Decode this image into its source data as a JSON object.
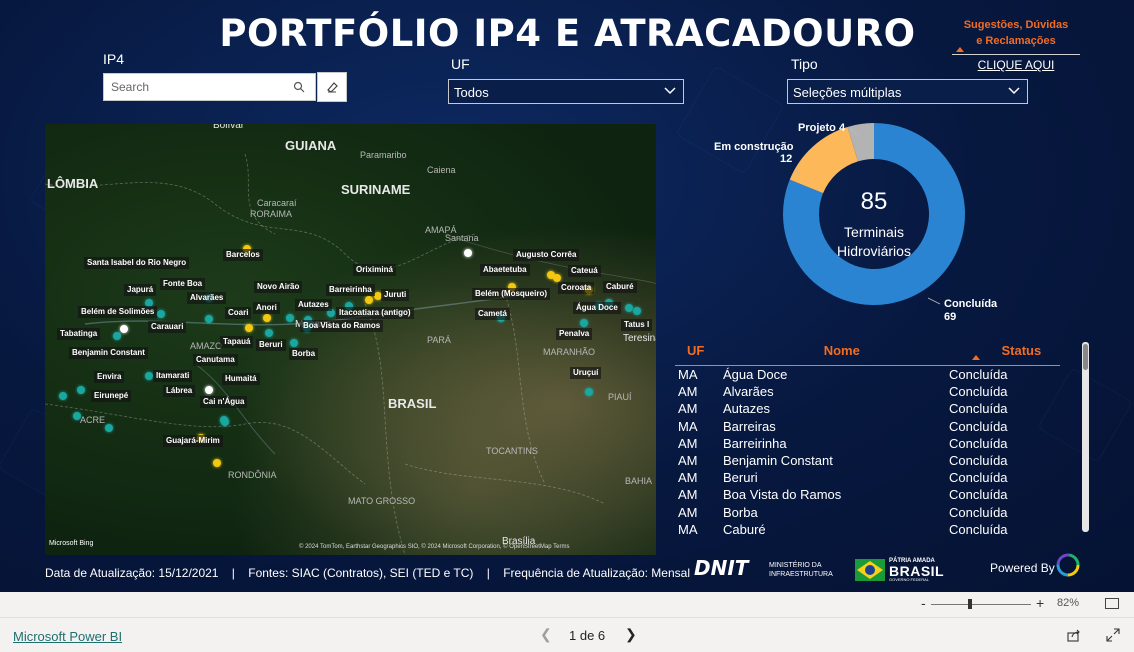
{
  "title": "PORTFÓLIO IP4 E ATRACADOURO",
  "feedback": {
    "line1": "Sugestões, Dúvidas",
    "line2": "e Reclamações",
    "link": "CLIQUE AQUI"
  },
  "filters": {
    "ip4": {
      "label": "IP4",
      "placeholder": "Search"
    },
    "uf": {
      "label": "UF",
      "value": "Todos"
    },
    "tipo": {
      "label": "Tipo",
      "value": "Seleções múltiplas"
    }
  },
  "map": {
    "regions": [
      {
        "text": "Bolívar",
        "cls": "rlbl"
      },
      {
        "text": "GUIANA",
        "cls": "rlbl big"
      },
      {
        "text": "Paramaribo",
        "cls": "rlbl dim"
      },
      {
        "text": "Caiena",
        "cls": "rlbl dim"
      },
      {
        "text": "LÔMBIA",
        "cls": "rlbl big"
      },
      {
        "text": "SURINAME",
        "cls": "rlbl big"
      },
      {
        "text": "Caracaraí",
        "cls": "rlbl dim"
      },
      {
        "text": "RORAIMA",
        "cls": "rlbl dim"
      },
      {
        "text": "AMAPÁ",
        "cls": "rlbl dim"
      },
      {
        "text": "Santana",
        "cls": "rlbl dim"
      },
      {
        "text": "AMAZO",
        "cls": "rlbl dim"
      },
      {
        "text": "PARÁ",
        "cls": "rlbl dim"
      },
      {
        "text": "MARANHÃO",
        "cls": "rlbl dim"
      },
      {
        "text": "Teresina",
        "cls": "rlbl"
      },
      {
        "text": "PIAUÍ",
        "cls": "rlbl dim"
      },
      {
        "text": "BRASIL",
        "cls": "rlbl big"
      },
      {
        "text": "ACRE",
        "cls": "rlbl dim"
      },
      {
        "text": "RONDÔNIA",
        "cls": "rlbl dim"
      },
      {
        "text": "TOCANTINS",
        "cls": "rlbl dim"
      },
      {
        "text": "MATO GROSSO",
        "cls": "rlbl dim"
      },
      {
        "text": "BAHIA",
        "cls": "rlbl dim"
      },
      {
        "text": "Brasília",
        "cls": "rlbl"
      },
      {
        "text": "Manaus",
        "cls": "rlbl"
      }
    ],
    "labels": [
      "Santa Isabel do Rio Negro",
      "Barcelos",
      "Japurá",
      "Fonte Boa",
      "Alvarães",
      "Novo Airão",
      "Oriximiná",
      "Augusto Corrêa",
      "Abaetetuba",
      "Cateuá",
      "Coroata",
      "Caburé",
      "Juruti",
      "Barreirinha",
      "Autazes",
      "Belém de Solimões",
      "Coari",
      "Anori",
      "Itacoatiara (antigo)",
      "Belém (Mosqueiro)",
      "Água Doce",
      "Tatus I",
      "Cametá",
      "Tabatinga",
      "Carauari",
      "Boa Vista do Ramos",
      "Penalva",
      "Benjamin Constant",
      "Tapauá",
      "Beruri",
      "Borba",
      "Canutama",
      "Envira",
      "Itamarati",
      "Humaitá",
      "Uruçuí",
      "Eirunepé",
      "Lábrea",
      "Cai n'Água",
      "Guajará-Mirim"
    ],
    "attribution": "© 2024 TomTom, Earthstar Geographics SIO, © 2024 Microsoft Corporation, © OpenStreetMap Terms",
    "bing": "Microsoft Bing"
  },
  "donut": {
    "total": "85",
    "center_label_1": "Terminais",
    "center_label_2": "Hidroviários",
    "colors": {
      "Concluída": "#2a84d2",
      "Em construção": "#fdb85a",
      "Projeto": "#b3b3b3"
    }
  },
  "chart_data": {
    "type": "pie",
    "title": "",
    "categories": [
      "Concluída",
      "Em construção",
      "Projeto"
    ],
    "values": [
      69,
      12,
      4
    ],
    "total": 85
  },
  "table": {
    "headers": {
      "uf": "UF",
      "nome": "Nome",
      "status": "Status"
    },
    "rows": [
      {
        "uf": "MA",
        "nome": "Água Doce",
        "status": "Concluída"
      },
      {
        "uf": "AM",
        "nome": "Alvarães",
        "status": "Concluída"
      },
      {
        "uf": "AM",
        "nome": "Autazes",
        "status": "Concluída"
      },
      {
        "uf": "MA",
        "nome": "Barreiras",
        "status": "Concluída"
      },
      {
        "uf": "AM",
        "nome": "Barreirinha",
        "status": "Concluída"
      },
      {
        "uf": "AM",
        "nome": "Benjamin Constant",
        "status": "Concluída"
      },
      {
        "uf": "AM",
        "nome": "Beruri",
        "status": "Concluída"
      },
      {
        "uf": "AM",
        "nome": "Boa Vista do Ramos",
        "status": "Concluída"
      },
      {
        "uf": "AM",
        "nome": "Borba",
        "status": "Concluída"
      },
      {
        "uf": "MA",
        "nome": "Caburé",
        "status": "Concluída"
      }
    ]
  },
  "footer": {
    "info": "Data de Atualização: 15/12/2021    |    Fontes: SIAC (Contratos), SEI (TED e TC)    |    Frequência de Atualização: Mensal",
    "dnit": "DNIT",
    "ministerio": "MINISTÉRIO DA\nINFRAESTRUTURA",
    "patria": "PÁTRIA AMADA",
    "brasil": "BRASIL",
    "governo": "GOVERNO FEDERAL",
    "powered": "Powered By"
  },
  "viewer": {
    "zoom": "82%",
    "pbi_link": "Microsoft Power BI",
    "page": "1 de 6"
  }
}
